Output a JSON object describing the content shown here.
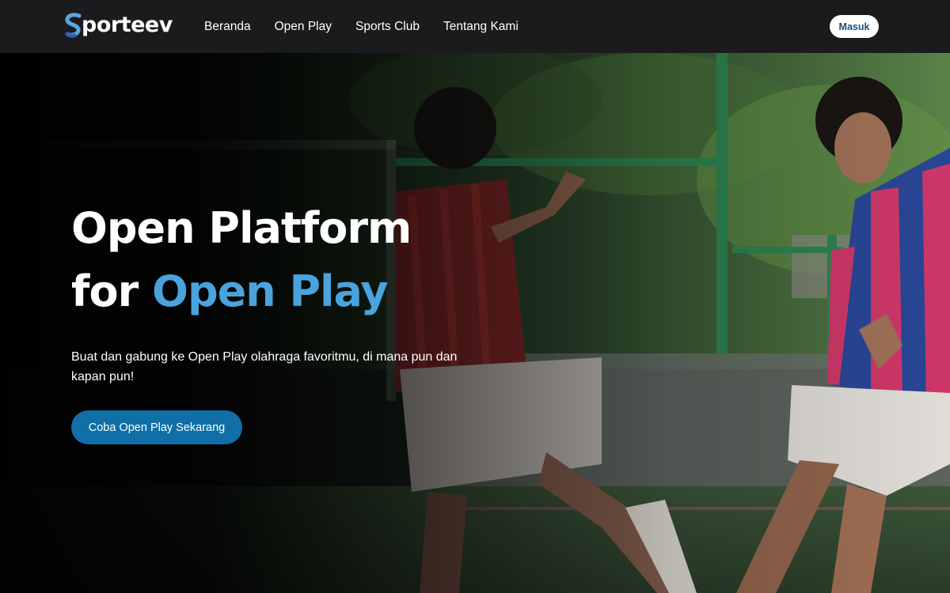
{
  "brand": {
    "name": "Sporteev",
    "logo_text": "porteev"
  },
  "nav": {
    "items": [
      {
        "label": "Beranda"
      },
      {
        "label": "Open Play"
      },
      {
        "label": "Sports Club"
      },
      {
        "label": "Tentang Kami"
      }
    ],
    "login_label": "Masuk"
  },
  "hero": {
    "title_line1": "Open Platform",
    "title_line2_prefix": "for",
    "title_line2_accent": "Open Play",
    "subtitle": "Buat dan gabung ke Open Play olahraga favoritmu, di mana pun dan kapan pun!",
    "cta_label": "Coba Open Play Sekarang"
  },
  "colors": {
    "navbar_bg": "#1b1b1e",
    "accent": "#4aa3dd",
    "cta_bg": "#0f6fa6",
    "login_text": "#1a4f7a"
  }
}
